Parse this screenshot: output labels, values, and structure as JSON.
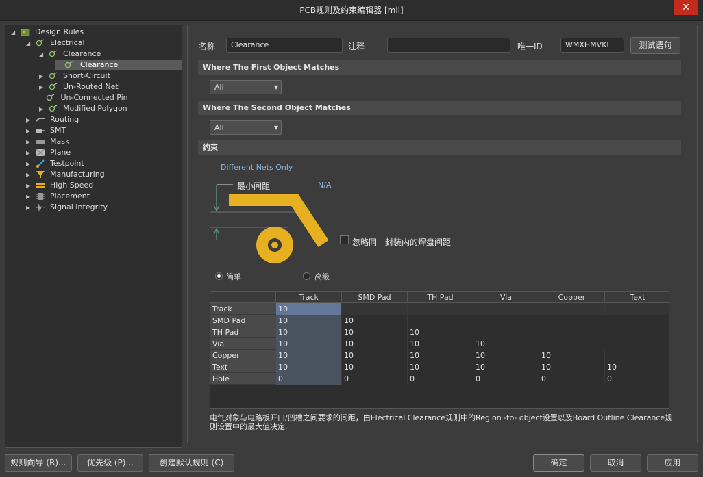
{
  "window": {
    "title": "PCB规则及约束编辑器 [mil]",
    "close": "✕"
  },
  "tree": {
    "root": "Design Rules",
    "electrical": "Electrical",
    "clearance_group": "Clearance",
    "clearance_rule": "Clearance",
    "short_circuit": "Short-Circuit",
    "unrouted_net": "Un-Routed Net",
    "unconnected_pin": "Un-Connected Pin",
    "modified_polygon": "Modified Polygon",
    "routing": "Routing",
    "smt": "SMT",
    "mask": "Mask",
    "plane": "Plane",
    "testpoint": "Testpoint",
    "manufacturing": "Manufacturing",
    "high_speed": "High Speed",
    "placement": "Placement",
    "signal_integrity": "Signal Integrity"
  },
  "rule": {
    "name_label": "名称",
    "name_value": "Clearance",
    "comment_label": "注释",
    "comment_value": "",
    "uid_label": "唯一ID",
    "uid_value": "WMXHMVKI",
    "test_button": "测试语句"
  },
  "first_match": {
    "header": "Where The First Object Matches",
    "value": "All"
  },
  "second_match": {
    "header": "Where The Second Object Matches",
    "value": "All"
  },
  "constraints": {
    "header": "约束",
    "different_nets": "Different Nets Only",
    "min_clearance": "最小间距",
    "na": "N/A",
    "ignore_pads": "忽略同一封装内的焊盘间距",
    "simple": "简单",
    "advanced": "高级"
  },
  "grid": {
    "columns": [
      "Track",
      "SMD Pad",
      "TH Pad",
      "Via",
      "Copper",
      "Text"
    ],
    "rows": [
      {
        "label": "Track",
        "values": [
          "10"
        ]
      },
      {
        "label": "SMD Pad",
        "values": [
          "10",
          "10"
        ]
      },
      {
        "label": "TH Pad",
        "values": [
          "10",
          "10",
          "10"
        ]
      },
      {
        "label": "Via",
        "values": [
          "10",
          "10",
          "10",
          "10"
        ]
      },
      {
        "label": "Copper",
        "values": [
          "10",
          "10",
          "10",
          "10",
          "10"
        ]
      },
      {
        "label": "Text",
        "values": [
          "10",
          "10",
          "10",
          "10",
          "10",
          "10"
        ]
      },
      {
        "label": "Hole",
        "values": [
          "0",
          "0",
          "0",
          "0",
          "0",
          "0"
        ]
      }
    ]
  },
  "note": "电气对象与电路板开口/凹槽之间要求的间距，由Electrical Clearance规则中的Region -to- object设置以及Board Outline Clearance规则设置中的最大值决定.",
  "footer": {
    "wizard": "规则向导 (R)...",
    "priority": "优先级 (P)...",
    "create_default": "创建默认规则 (C)",
    "ok": "确定",
    "cancel": "取消",
    "apply": "应用"
  },
  "colors": {
    "accent": "#e6b020",
    "selection": "#637899"
  }
}
